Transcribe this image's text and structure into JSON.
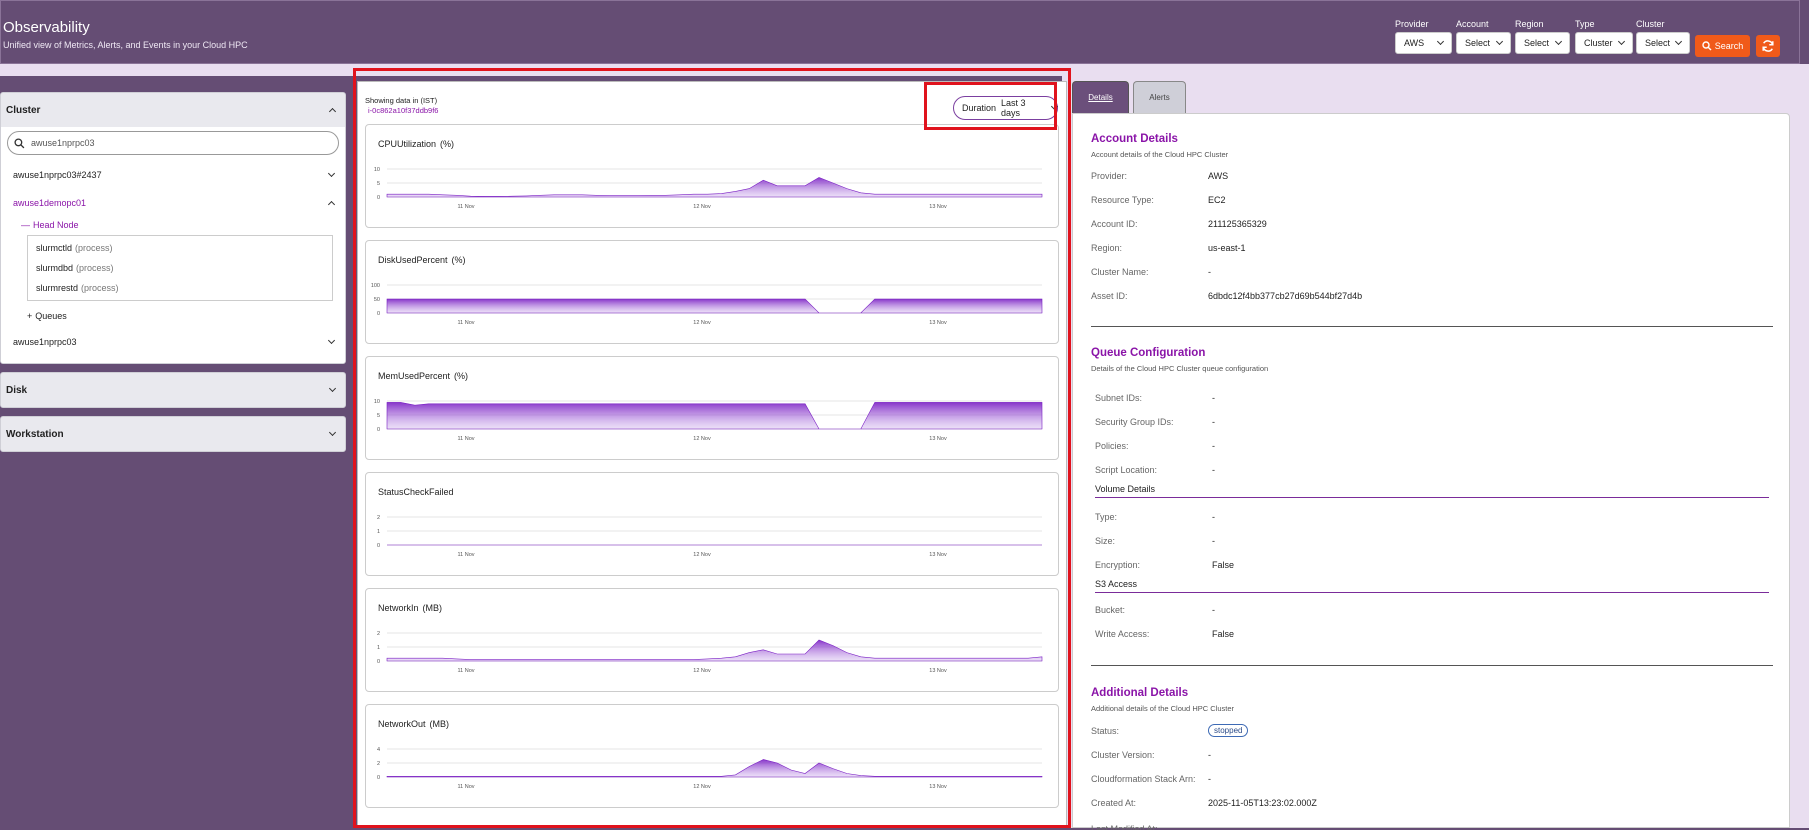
{
  "header": {
    "title": "Observability",
    "subtitle": "Unified view of Metrics, Alerts, and Events in your Cloud HPC",
    "filters": [
      {
        "label": "Provider",
        "value": "AWS"
      },
      {
        "label": "Account",
        "value": "Select"
      },
      {
        "label": "Region",
        "value": "Select"
      },
      {
        "label": "Type",
        "value": "Cluster"
      },
      {
        "label": "Cluster",
        "value": "Select"
      }
    ],
    "search_label": "Search",
    "accent": "#f05a1a"
  },
  "sidebar": {
    "cluster_title": "Cluster",
    "search_value": "awuse1nprpc03",
    "items": [
      "awuse1nprpc03#2437",
      "awuse1demopc01",
      "awuse1nprpc03"
    ],
    "head_node_label": "Head Node",
    "processes": [
      {
        "name": "slurmctld",
        "tag": "(process)"
      },
      {
        "name": "slurmdbd",
        "tag": "(process)"
      },
      {
        "name": "slurmrestd",
        "tag": "(process)"
      }
    ],
    "queues_label": "Queues",
    "disk_title": "Disk",
    "workstation_title": "Workstation"
  },
  "center": {
    "showing": "Showing data in (IST)",
    "instance_id": "i-0c862a10f37ddb9f6",
    "duration_label": "Duration",
    "duration_value": "Last 3 days"
  },
  "metrics": [
    {
      "title": "CPUUtilization",
      "unit": "(%)",
      "ticks": [
        "10",
        "5",
        "0"
      ],
      "ymax": 10,
      "values": [
        1,
        1,
        1,
        1,
        0.8,
        0.6,
        0.3,
        0.2,
        0.2,
        0.3,
        0.4,
        0.6,
        0.8,
        0.8,
        0.8,
        0.6,
        0.5,
        0.5,
        0.5,
        0.6,
        0.6,
        0.8,
        1,
        1,
        1.2,
        2,
        3,
        6,
        4,
        4,
        4,
        7,
        5,
        3,
        1.5,
        1,
        1,
        1,
        1,
        1,
        1,
        1,
        1,
        1,
        1,
        1,
        1,
        1
      ]
    },
    {
      "title": "DiskUsedPercent",
      "unit": "(%)",
      "ticks": [
        "100",
        "50",
        "0"
      ],
      "ymax": 100,
      "values": [
        50,
        50,
        50,
        50,
        50,
        50,
        50,
        50,
        50,
        50,
        50,
        50,
        50,
        50,
        50,
        50,
        50,
        50,
        50,
        50,
        50,
        50,
        50,
        50,
        50,
        50,
        50,
        50,
        50,
        50,
        50,
        0,
        0,
        0,
        0,
        50,
        50,
        50,
        50,
        50,
        50,
        50,
        50,
        50,
        50,
        50,
        50,
        50
      ]
    },
    {
      "title": "MemUsedPercent",
      "unit": "(%)",
      "ticks": [
        "10",
        "5",
        "0"
      ],
      "ymax": 10,
      "values": [
        9.5,
        9.5,
        8.5,
        9,
        9,
        9,
        9,
        9,
        9,
        9,
        9,
        9,
        9,
        9,
        9,
        9,
        9,
        9,
        9,
        9,
        9,
        9,
        9,
        9,
        9,
        9,
        9,
        9,
        9,
        9,
        9,
        0,
        0,
        0,
        0,
        9.5,
        9.5,
        9.5,
        9.5,
        9.5,
        9.5,
        9.5,
        9.5,
        9.5,
        9.5,
        9.5,
        9.5,
        9.5
      ]
    },
    {
      "title": "StatusCheckFailed",
      "unit": "",
      "ticks": [
        "2",
        "1",
        "0"
      ],
      "ymax": 2,
      "values": [
        0,
        0,
        0,
        0,
        0,
        0,
        0,
        0,
        0,
        0,
        0,
        0,
        0,
        0,
        0,
        0,
        0,
        0,
        0,
        0,
        0,
        0,
        0,
        0,
        0,
        0,
        0,
        0,
        0,
        0,
        0,
        0,
        0,
        0,
        0,
        0,
        0,
        0,
        0,
        0,
        0,
        0,
        0,
        0,
        0,
        0,
        0,
        0
      ]
    },
    {
      "title": "NetworkIn",
      "unit": "(MB)",
      "ticks": [
        "2",
        "1",
        "0"
      ],
      "ymax": 2,
      "values": [
        0.2,
        0.2,
        0.2,
        0.2,
        0.2,
        0.15,
        0.1,
        0.1,
        0.1,
        0.1,
        0.1,
        0.1,
        0.1,
        0.1,
        0.1,
        0.1,
        0.1,
        0.1,
        0.1,
        0.1,
        0.1,
        0.1,
        0.1,
        0.15,
        0.2,
        0.3,
        0.6,
        0.8,
        0.5,
        0.5,
        0.5,
        1.5,
        1.1,
        0.6,
        0.3,
        0.2,
        0.2,
        0.2,
        0.2,
        0.2,
        0.2,
        0.2,
        0.2,
        0.2,
        0.2,
        0.2,
        0.2,
        0.3
      ]
    },
    {
      "title": "NetworkOut",
      "unit": "(MB)",
      "ticks": [
        "4",
        "2",
        "0"
      ],
      "ymax": 4,
      "values": [
        0.1,
        0.1,
        0.1,
        0.1,
        0.1,
        0.1,
        0.1,
        0.1,
        0.1,
        0.1,
        0.1,
        0.1,
        0.1,
        0.1,
        0.1,
        0.1,
        0.1,
        0.1,
        0.1,
        0.1,
        0.1,
        0.1,
        0.1,
        0.1,
        0.1,
        0.3,
        1.5,
        2.5,
        2,
        1,
        0.5,
        2,
        1.2,
        0.5,
        0.2,
        0.1,
        0.1,
        0.1,
        0.1,
        0.1,
        0.1,
        0.1,
        0.1,
        0.1,
        0.1,
        0.1,
        0.1,
        0.1
      ]
    }
  ],
  "x_ticks": [
    "11 Nov",
    "12 Nov",
    "13 Nov"
  ],
  "tabs": {
    "details": "Details",
    "alerts": "Alerts"
  },
  "account_details": {
    "title": "Account Details",
    "subtitle": "Account details of the Cloud HPC Cluster",
    "rows": [
      {
        "k": "Provider:",
        "v": "AWS"
      },
      {
        "k": "Resource Type:",
        "v": "EC2"
      },
      {
        "k": "Account ID:",
        "v": "211125365329"
      },
      {
        "k": "Region:",
        "v": "us-east-1"
      },
      {
        "k": "Cluster Name:",
        "v": "-"
      },
      {
        "k": "Asset ID:",
        "v": "6dbdc12f4bb377cb27d69b544bf27d4b"
      }
    ]
  },
  "queue_config": {
    "title": "Queue Configuration",
    "subtitle": "Details of the Cloud HPC Cluster queue configuration",
    "rows": [
      {
        "k": "Subnet IDs:",
        "v": "-"
      },
      {
        "k": "Security Group IDs:",
        "v": "-"
      },
      {
        "k": "Policies:",
        "v": "-"
      },
      {
        "k": "Script Location:",
        "v": "-"
      }
    ],
    "volume_title": "Volume Details",
    "volume_rows": [
      {
        "k": "Type:",
        "v": "-"
      },
      {
        "k": "Size:",
        "v": "-"
      },
      {
        "k": "Encryption:",
        "v": "False"
      }
    ],
    "s3_title": "S3 Access",
    "s3_rows": [
      {
        "k": "Bucket:",
        "v": "-"
      },
      {
        "k": "Write Access:",
        "v": "False"
      }
    ]
  },
  "additional": {
    "title": "Additional Details",
    "subtitle": "Additional details of the Cloud HPC Cluster",
    "status_label": "Status:",
    "status_value": "stopped",
    "rows": [
      {
        "k": "Cluster Version:",
        "v": "-"
      },
      {
        "k": "Cloudformation Stack Arn:",
        "v": "-"
      },
      {
        "k": "Created At:",
        "v": "2025-11-05T13:23:02.000Z"
      }
    ],
    "last_modified_label": "Last Modified At:"
  }
}
